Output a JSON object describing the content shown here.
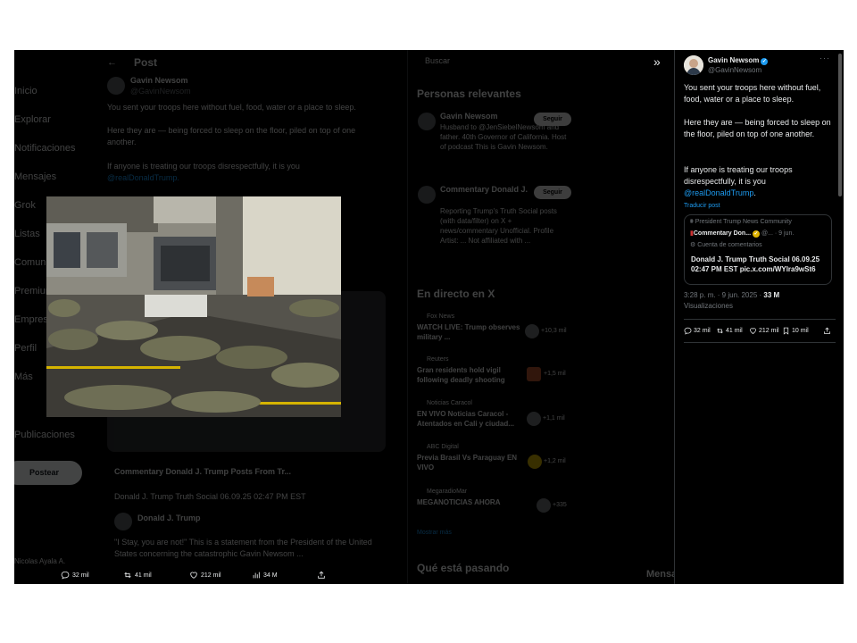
{
  "background_timeline": {
    "header_title": "Post",
    "search_label": "Buscar",
    "nav_items": [
      "Inicio",
      "Explorar",
      "Notificaciones",
      "Mensajes",
      "Grok",
      "Listas",
      "Comunidades",
      "Premium",
      "Empresas",
      "Perfil",
      "Más",
      "Publicaciones"
    ],
    "post_button": "Postear",
    "account_label": "Nicolas Ayala A.",
    "author": "Gavin Newsom",
    "handle": "@GavinNewsom",
    "paragraphs": [
      "You sent your troops here without fuel, food, water or a place to sleep.",
      "Here they are — being forced to sleep on the floor, piled on top of one another.",
      "If anyone is treating our troops disrespectfully, it is you",
      "@realDonaldTrump."
    ],
    "bg_quote_title": "Commentary Donald J. Trump Posts From Tr...",
    "bg_quote_text": "Donald J. Trump Truth Social 06.09.25 02:47 PM EST",
    "bg_reply_name": "Donald J. Trump",
    "bg_reply_text": "\"I Stay, you are not!\" This is a statement from the President of the United States concerning the catastrophic Gavin Newsom ...",
    "relevant_header": "Personas relevantes",
    "relevant": [
      {
        "name": "Gavin Newsom",
        "bio": "Husband to @JenSiebelNewsom and father. 40th Governor of California. Host of podcast This is Gavin Newsom.",
        "btn": "Seguir"
      },
      {
        "name": "Commentary Donald J.",
        "bio": "Reporting Trump's Truth Social posts (with data/filter) on X + news/commentary Unofficial. Profile Artist: ... Not affiliated with ...",
        "btn": "Seguir"
      }
    ],
    "live_header": "En directo en X",
    "live": [
      {
        "source": "Fox News",
        "title": "WATCH LIVE: Trump observes military ...",
        "count": "+10,3 mil"
      },
      {
        "source": "Reuters",
        "title": "Gran residents hold vigil following deadly shooting",
        "count": "+1,5 mil"
      },
      {
        "source": "Noticias Caracol",
        "title": "EN VIVO Noticias Caracol - Atentados en Cali y ciudad...",
        "count": "+1,1 mil"
      },
      {
        "source": "ABC Digital",
        "title": "Previa Brasil Vs Paraguay EN VIVO",
        "count": "+1,2 mil"
      },
      {
        "source": "MegaradioMar",
        "title": "MEGANOTICIAS AHORA",
        "count": "+335"
      }
    ],
    "show_more": "Mostrar más",
    "trending_header": "Qué está pasando",
    "messages_label": "Mensajes"
  },
  "bottom_bar": {
    "replies": "32 mil",
    "reposts": "41 mil",
    "likes": "212 mil",
    "views": "34 M"
  },
  "tweet": {
    "author": "Gavin Newsom",
    "handle": "@GavinNewsom",
    "p1": "You sent your troops here without fuel, food, water or a place to sleep.",
    "p2": "Here they are — being forced to sleep on the floor, piled on top of one another.",
    "p3_text": "If anyone is treating our troops disrespectfully, it is you ",
    "p3_mention": "@realDonaldTrump",
    "p3_end": ".",
    "translate": "Traducir post",
    "quote": {
      "community": "President Trump News Community",
      "name": "Commentary Don...",
      "meta": "@... · 9 jun.",
      "account_type": "Cuenta de comentarios",
      "text": "Donald J. Trump Truth Social 06.09.25 02:47 PM EST pic.x.com/WYlra9wSt6"
    },
    "time": "3:28 p. m. · 9 jun. 2025 · ",
    "views": "33 M",
    "views_label": "Visualizaciones",
    "actions": {
      "replies": "32 mil",
      "reposts": "41 mil",
      "likes": "212 mil",
      "bookmarks": "10 mil"
    }
  },
  "colors": {
    "accent": "#1d9bf0",
    "background": "#000000",
    "text": "#e7e9ea",
    "muted": "#71767b"
  }
}
